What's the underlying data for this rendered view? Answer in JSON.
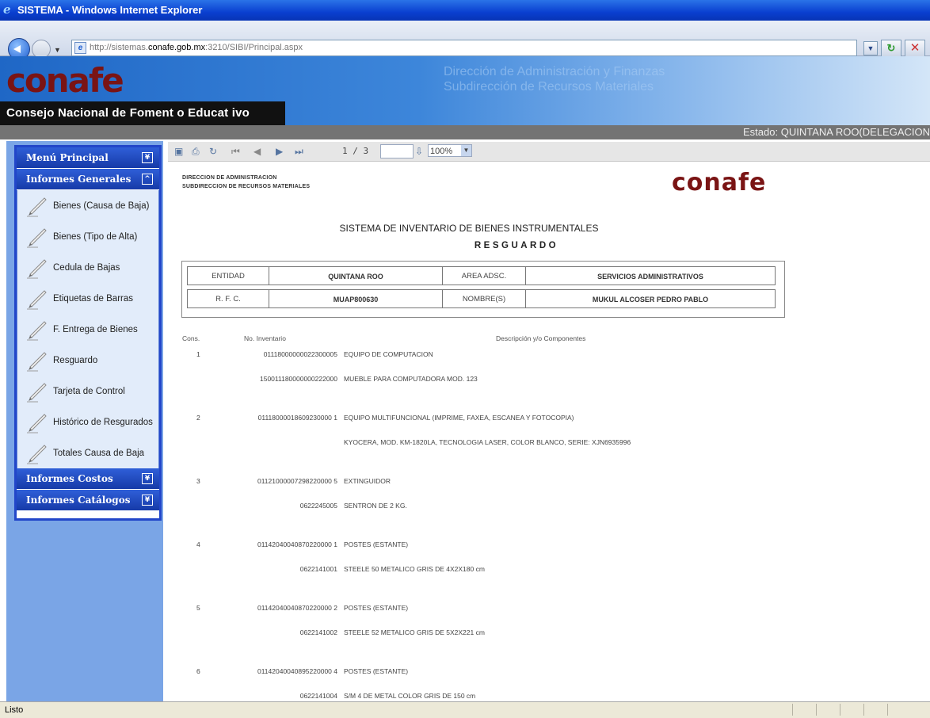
{
  "window": {
    "title": "SISTEMA - Windows Internet Explorer"
  },
  "address": {
    "url_prefix": "http://sistemas.",
    "url_domain": "conafe.gob.mx",
    "url_suffix": ":3210/SIBI/Principal.aspx"
  },
  "banner": {
    "logo": "CONAFE",
    "subtitle": "Consejo Nacional de Foment o Educat ivo",
    "faded_line1": "Dirección de Administración y Finanzas",
    "faded_line2": "Subdirección de Recursos Materiales",
    "state": "Estado: QUINTANA ROO(DELEGACION"
  },
  "menu": {
    "principal": "Menú Principal",
    "generales": "Informes Generales",
    "items": [
      "Bienes (Causa de Baja)",
      "Bienes (Tipo de Alta)",
      "Cedula de Bajas",
      "Etiquetas de Barras",
      "F. Entrega de Bienes",
      "Resguardo",
      "Tarjeta de Control",
      "Histórico de Resgurados",
      "Totales Causa de Baja"
    ],
    "costos": "Informes Costos",
    "catalogos": "Informes Catálogos"
  },
  "toolbar": {
    "page": "1 / 3",
    "zoom": "100%"
  },
  "report": {
    "header1": "DIRECCION DE ADMINISTRACION",
    "header2": "SUBDIRECCION DE RECURSOS MATERIALES",
    "logo": "CONAFE",
    "title": "SISTEMA DE INVENTARIO DE BIENES INSTRUMENTALES",
    "subtitle": "RESGUARDO",
    "info": {
      "entidad_label": "ENTIDAD",
      "entidad_value": "QUINTANA ROO",
      "area_label": "AREA ADSC.",
      "area_value": "SERVICIOS ADMINISTRATIVOS",
      "rfc_label": "R. F. C.",
      "rfc_value": "MUAP800630",
      "nombre_label": "NOMBRE(S)",
      "nombre_value": "MUKUL ALCOSER PEDRO PABLO"
    },
    "columns": {
      "cons": "Cons.",
      "inventario": "No. Inventario",
      "descripcion": "Descripción y/o Componentes"
    },
    "rows": [
      {
        "cons": "1",
        "inv1": "01118000000022300005",
        "desc1": "EQUIPO DE COMPUTACION",
        "inv2": "150011180000000222000",
        "desc2": "MUEBLE PARA COMPUTADORA MOD. 123"
      },
      {
        "cons": "2",
        "inv1": "01118000018609230000 1",
        "desc1": "EQUIPO MULTIFUNCIONAL (IMPRIME, FAXEA, ESCANEA Y FOTOCOPIA)",
        "inv2": "",
        "desc2": "KYOCERA, MOD. KM-1820LA, TECNOLOGIA LASER, COLOR BLANCO, SERIE: XJN6935996"
      },
      {
        "cons": "3",
        "inv1": "01121000007298220000 5",
        "desc1": "EXTINGUIDOR",
        "inv2": "0622245005",
        "desc2": "SENTRON DE 2 KG."
      },
      {
        "cons": "4",
        "inv1": "01142040040870220000 1",
        "desc1": "POSTES (ESTANTE)",
        "inv2": "0622141001",
        "desc2": "STEELE 50 METALICO GRIS DE 4X2X180 cm"
      },
      {
        "cons": "5",
        "inv1": "01142040040870220000 2",
        "desc1": "POSTES (ESTANTE)",
        "inv2": "0622141002",
        "desc2": "STEELE 52 METALICO GRIS DE 5X2X221 cm"
      },
      {
        "cons": "6",
        "inv1": "01142040040895220000 4",
        "desc1": "POSTES (ESTANTE)",
        "inv2": "0622141004",
        "desc2": "S/M 4 DE METAL COLOR GRIS DE 150 cm"
      }
    ]
  },
  "status": {
    "text": "Listo"
  },
  "colors": {
    "menu_border": "#2246c9",
    "logo_red": "#7a1414",
    "banner_blue": "#1f67c6"
  }
}
